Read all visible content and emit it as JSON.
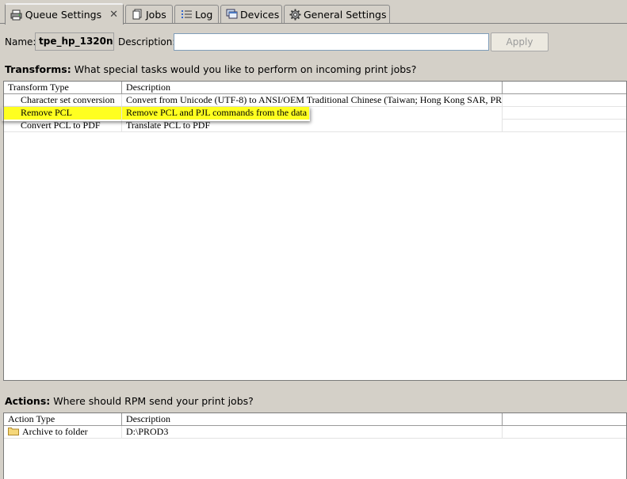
{
  "tabs": [
    {
      "label": "Queue Settings",
      "icon": "printer-icon",
      "active": true
    },
    {
      "label": "Jobs",
      "icon": "jobs-icon"
    },
    {
      "label": "Log",
      "icon": "log-list-icon"
    },
    {
      "label": "Devices",
      "icon": "devices-icon"
    },
    {
      "label": "General Settings",
      "icon": "gear-icon"
    }
  ],
  "queue": {
    "name_label": "Name:",
    "name_value": "tpe_hp_1320n",
    "description_label": "Description:",
    "description_value": "",
    "apply_label": "Apply"
  },
  "transforms": {
    "title_bold": "Transforms:",
    "title_text": " What special tasks would you like to perform on incoming print jobs?",
    "columns": [
      "Transform Type",
      "Description",
      ""
    ],
    "rows": [
      {
        "type": "Character set conversion",
        "description": "Convert from Unicode (UTF-8) to ANSI/OEM Traditional Chinese (Taiwan; Hong Kong SAR, PR..."
      },
      {
        "type": "Remove PCL",
        "description": "Remove PCL and PJL commands from the data",
        "highlighted": true
      },
      {
        "type": "Convert PCL to PDF",
        "description": "Translate PCL to PDF"
      }
    ]
  },
  "actions": {
    "title_bold": "Actions:",
    "title_text": " Where should RPM send your print jobs?",
    "columns": [
      "Action Type",
      "Description",
      ""
    ],
    "rows": [
      {
        "type": "Archive to folder",
        "description": "D:\\PROD3",
        "icon": "folder-icon"
      }
    ]
  },
  "colors": {
    "highlight": "#ffff20",
    "background": "#d4d0c8",
    "folder": "#f5d77a"
  }
}
